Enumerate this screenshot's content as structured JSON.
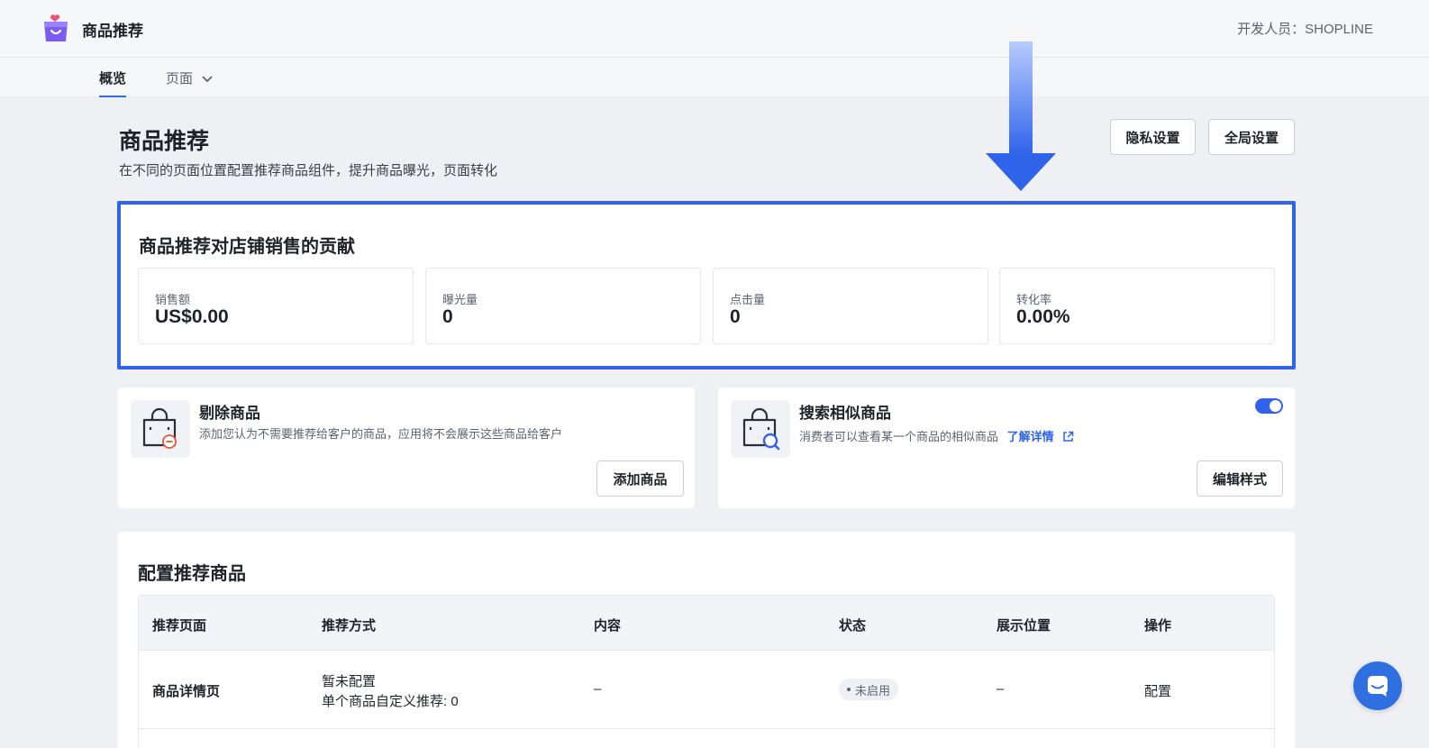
{
  "app": {
    "name": "商品推荐",
    "developer": "开发人员：SHOPLINE"
  },
  "nav": {
    "tabs": [
      {
        "label": "概览",
        "active": true
      },
      {
        "label": "页面",
        "active": false
      }
    ]
  },
  "header": {
    "title": "商品推荐",
    "description": "在不同的页面位置配置推荐商品组件，提升商品曝光，页面转化",
    "privacy_button": "隐私设置",
    "global_button": "全局设置"
  },
  "contribution": {
    "title": "商品推荐对店铺销售的贡献",
    "metrics": [
      {
        "label": "销售额",
        "value": "US$0.00"
      },
      {
        "label": "曝光量",
        "value": "0"
      },
      {
        "label": "点击量",
        "value": "0"
      },
      {
        "label": "转化率",
        "value": "0.00%"
      }
    ]
  },
  "exclude": {
    "title": "剔除商品",
    "description": "添加您认为不需要推荐给客户的商品，应用将不会展示这些商品给客户",
    "button": "添加商品"
  },
  "similar": {
    "title": "搜索相似商品",
    "description": "消费者可以查看某一个商品的相似商品",
    "link": "了解详情",
    "enabled": true,
    "button": "编辑样式"
  },
  "config": {
    "title": "配置推荐商品",
    "columns": [
      "推荐页面",
      "推荐方式",
      "内容",
      "状态",
      "展示位置",
      "操作"
    ],
    "rows": [
      {
        "page": "商品详情页",
        "method_line1": "暂未配置",
        "method_line2": "单个商品自定义推荐: 0",
        "content": "–",
        "status": "未启用",
        "position": "–",
        "action": "配置"
      }
    ]
  },
  "colors": {
    "accent": "#2f63ea",
    "background": "#eef0f4"
  },
  "icons": [
    "app-logo-icon",
    "chevron-down-icon",
    "bag-remove-icon",
    "bag-search-icon",
    "external-link-icon",
    "chat-icon",
    "down-arrow-indicator"
  ]
}
